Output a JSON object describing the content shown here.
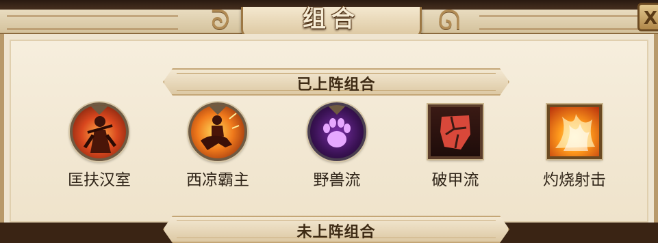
{
  "header": {
    "title": "组合",
    "close_label": "X"
  },
  "sections": {
    "active_title": "已上阵组合",
    "inactive_title": "未上阵组合"
  },
  "combos": [
    {
      "label": "匡扶汉室",
      "icon": "warrior-icon"
    },
    {
      "label": "西凉霸主",
      "icon": "cavalry-icon"
    },
    {
      "label": "野兽流",
      "icon": "beast-paw-icon"
    },
    {
      "label": "破甲流",
      "icon": "broken-armor-icon"
    },
    {
      "label": "灼烧射击",
      "icon": "flame-shot-icon"
    }
  ]
}
